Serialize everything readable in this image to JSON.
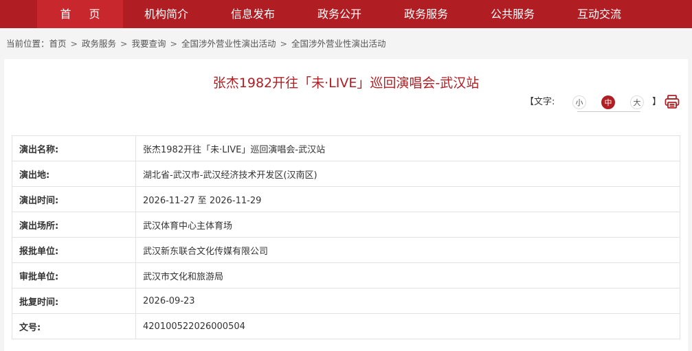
{
  "nav": {
    "items": [
      {
        "label": "首页"
      },
      {
        "label": "机构简介"
      },
      {
        "label": "信息发布"
      },
      {
        "label": "政务公开"
      },
      {
        "label": "政务服务"
      },
      {
        "label": "公共服务"
      },
      {
        "label": "互动交流"
      }
    ]
  },
  "breadcrumb": {
    "prefix": "当前位置：",
    "items": [
      "首页",
      "政务服务",
      "我要查询",
      "全国涉外营业性演出活动",
      "全国涉外营业性演出活动"
    ],
    "separator": ">"
  },
  "article": {
    "title": "张杰1982开往「未·LIVE」巡回演唱会-武汉站"
  },
  "font_size": {
    "label": "【文字:",
    "close": "】",
    "options": [
      "小",
      "中",
      "大"
    ],
    "selected": "中"
  },
  "icons": {
    "print": "print-icon"
  },
  "colors": {
    "brand": "#b01e23",
    "brand_active": "#c8282d"
  },
  "details": {
    "rows": [
      {
        "key": "演出名称:",
        "value": "张杰1982开往「未·LIVE」巡回演唱会-武汉站"
      },
      {
        "key": "演出地:",
        "value": "湖北省-武汉市-武汉经济技术开发区(汉南区)"
      },
      {
        "key": "演出时间:",
        "value": "2026-11-27 至 2026-11-29"
      },
      {
        "key": "演出场所:",
        "value": "武汉体育中心主体育场"
      },
      {
        "key": "报批单位:",
        "value": "武汉新东联合文化传媒有限公司"
      },
      {
        "key": "审批单位:",
        "value": "武汉市文化和旅游局"
      },
      {
        "key": "批复时间:",
        "value": "2026-09-23"
      },
      {
        "key": "文号:",
        "value": "420100522026000504"
      }
    ]
  }
}
